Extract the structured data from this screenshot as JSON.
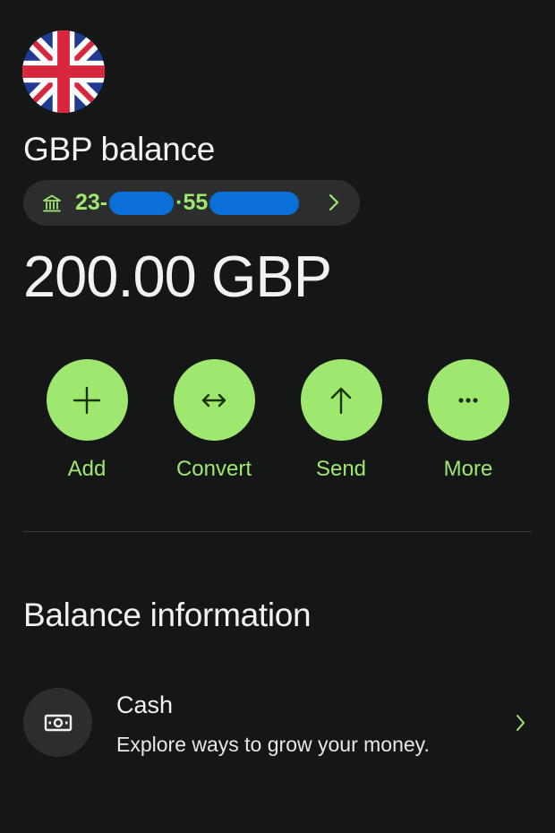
{
  "header": {
    "flag_icon": "uk-flag-icon",
    "title": "GBP balance"
  },
  "account": {
    "icon": "bank-icon",
    "part1": "23-",
    "part2": "·55",
    "chevron_icon": "chevron-right-icon",
    "redaction_color": "#0a6fd6"
  },
  "balance": {
    "amount": "200.00 GBP"
  },
  "actions": [
    {
      "label": "Add",
      "icon": "plus-icon"
    },
    {
      "label": "Convert",
      "icon": "swap-horizontal-icon"
    },
    {
      "label": "Send",
      "icon": "arrow-up-icon"
    },
    {
      "label": "More",
      "icon": "more-dots-icon"
    }
  ],
  "balance_info": {
    "title": "Balance information",
    "items": [
      {
        "title": "Cash",
        "subtitle": "Explore ways to grow your money.",
        "icon": "banknote-icon",
        "chevron_icon": "chevron-right-icon"
      }
    ]
  },
  "colors": {
    "background": "#151716",
    "accent": "#9fe870",
    "surface": "#2c2e2d",
    "text": "#f2f3f1"
  }
}
